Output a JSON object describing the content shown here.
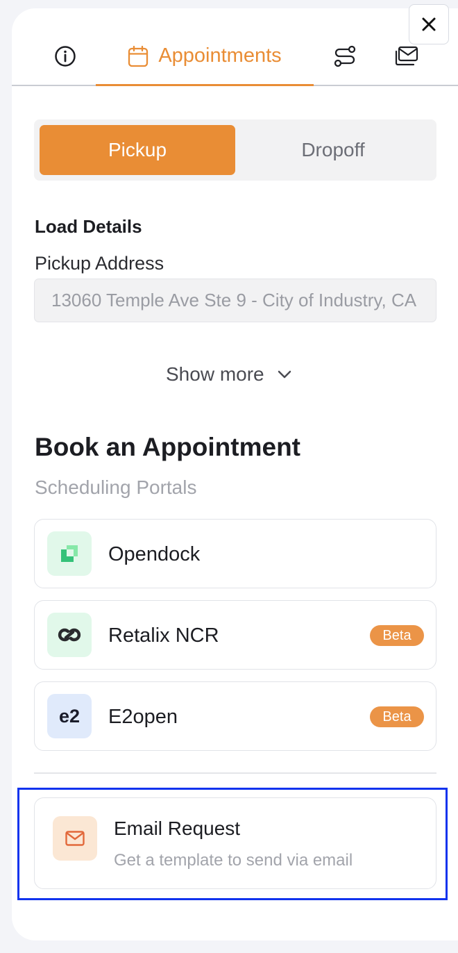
{
  "tabs": {
    "active_label": "Appointments",
    "items": [
      "info-tab",
      "appointments-tab",
      "routes-tab",
      "mail-tab"
    ]
  },
  "toggle": {
    "pickup": "Pickup",
    "dropoff": "Dropoff",
    "selected": "Pickup"
  },
  "load_details": {
    "heading": "Load Details",
    "address_label": "Pickup Address",
    "address_value": "13060 Temple Ave Ste 9 - City of Industry, CA"
  },
  "show_more": "Show more",
  "booking": {
    "heading": "Book an Appointment",
    "subheading": "Scheduling Portals",
    "portals": [
      {
        "name": "Opendock",
        "badge": "",
        "icon": "opendock-logo-icon"
      },
      {
        "name": "Retalix NCR",
        "badge": "Beta",
        "icon": "retalix-logo-icon"
      },
      {
        "name": "E2open",
        "badge": "Beta",
        "icon": "e2open-logo-icon",
        "logo_text": "e2"
      }
    ]
  },
  "email_request": {
    "title": "Email Request",
    "description": "Get a template to send via email"
  },
  "colors": {
    "accent": "#e98d35",
    "highlight_border": "#1133ee"
  }
}
